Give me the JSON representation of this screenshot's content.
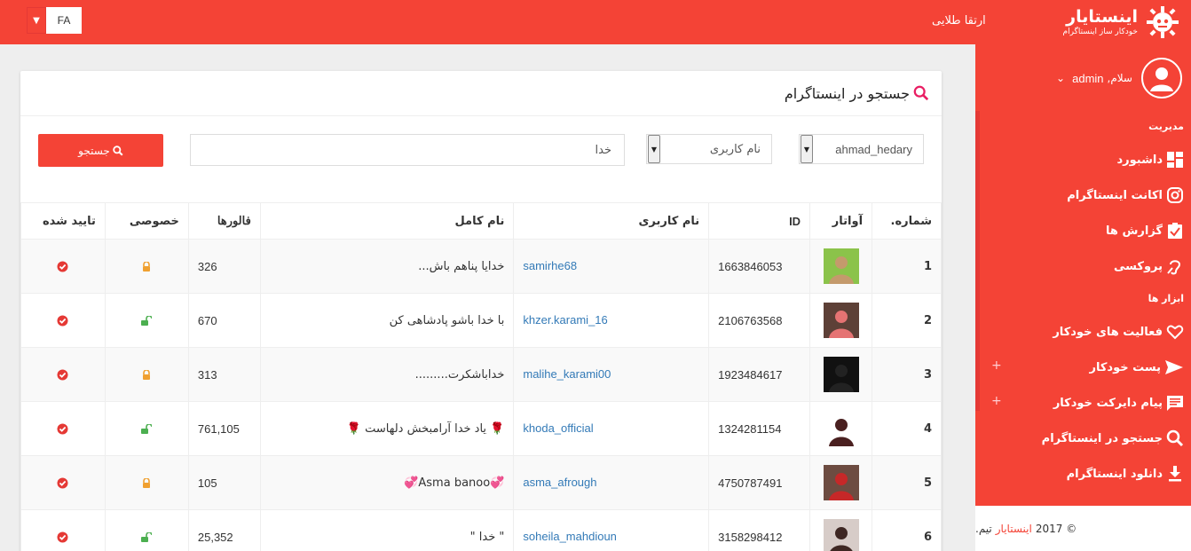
{
  "topbar": {
    "lang_label": "FA",
    "upgrade_label": "ارتقا طلایی",
    "brand_name": "اینستایار",
    "brand_tagline": "خودکار ساز اینستاگرام",
    "bg_color": "#f44336"
  },
  "sidebar": {
    "greeting": "سلام,",
    "username": "admin",
    "header_manage": "مدیریت",
    "header_tools": "ابزار ها",
    "items": [
      {
        "label": "داشبورد",
        "icon": "dashboard-icon"
      },
      {
        "label": "اکانت اینستاگرام",
        "icon": "instagram-icon"
      },
      {
        "label": "گزارش ها",
        "icon": "report-icon"
      },
      {
        "label": "پروکسی",
        "icon": "proxy-icon"
      },
      {
        "label": "فعالیت های خودکار",
        "icon": "heart-icon"
      },
      {
        "label": "پست خودکار",
        "icon": "send-icon"
      },
      {
        "label": "پیام دایرکت خودکار",
        "icon": "message-icon"
      },
      {
        "label": "جستجو در اینستاگرام",
        "icon": "search-icon"
      },
      {
        "label": "دانلود اینستاگرام",
        "icon": "download-icon"
      }
    ],
    "footer_year": "© 2017",
    "footer_brand": "اینستایار",
    "footer_team": "تیم."
  },
  "card": {
    "title": "جستجو در اینستاگرام",
    "search_button": "جستجو",
    "query_value": "خدا",
    "type_select": "نام کاربری",
    "account_select": "ahmad_hedary"
  },
  "table": {
    "headers": {
      "num": "شماره.",
      "avatar": "آواتار",
      "id": "ID",
      "username": "نام کاربری",
      "fullname": "نام کامل",
      "followers": "فالورها",
      "private": "خصوصی",
      "verified": "تایید شده"
    },
    "rows": [
      {
        "num": "1",
        "id": "1663846053",
        "username": "samirhe68",
        "fullname": "خدایا پناهم باش...",
        "followers": "326",
        "private": "locked"
      },
      {
        "num": "2",
        "id": "2106763568",
        "username": "khzer.karami_16",
        "fullname": "با خدا باشو پادشاهی کن",
        "followers": "670",
        "private": "unlocked"
      },
      {
        "num": "3",
        "id": "1923484617",
        "username": "malihe_karami00",
        "fullname": "خداباشکرت.........",
        "followers": "313",
        "private": "locked"
      },
      {
        "num": "4",
        "id": "1324281154",
        "username": "khoda_official",
        "fullname": "🌹 یاد خدا آرامبخش دلهاست 🌹",
        "followers": "761,105",
        "private": "unlocked"
      },
      {
        "num": "5",
        "id": "4750787491",
        "username": "asma_afrough",
        "fullname": "💞Asma banoo💞",
        "followers": "105",
        "private": "locked"
      },
      {
        "num": "6",
        "id": "3158298412",
        "username": "soheila_mahdioun",
        "fullname": "\" خدا \"",
        "followers": "25,352",
        "private": "unlocked"
      }
    ]
  }
}
